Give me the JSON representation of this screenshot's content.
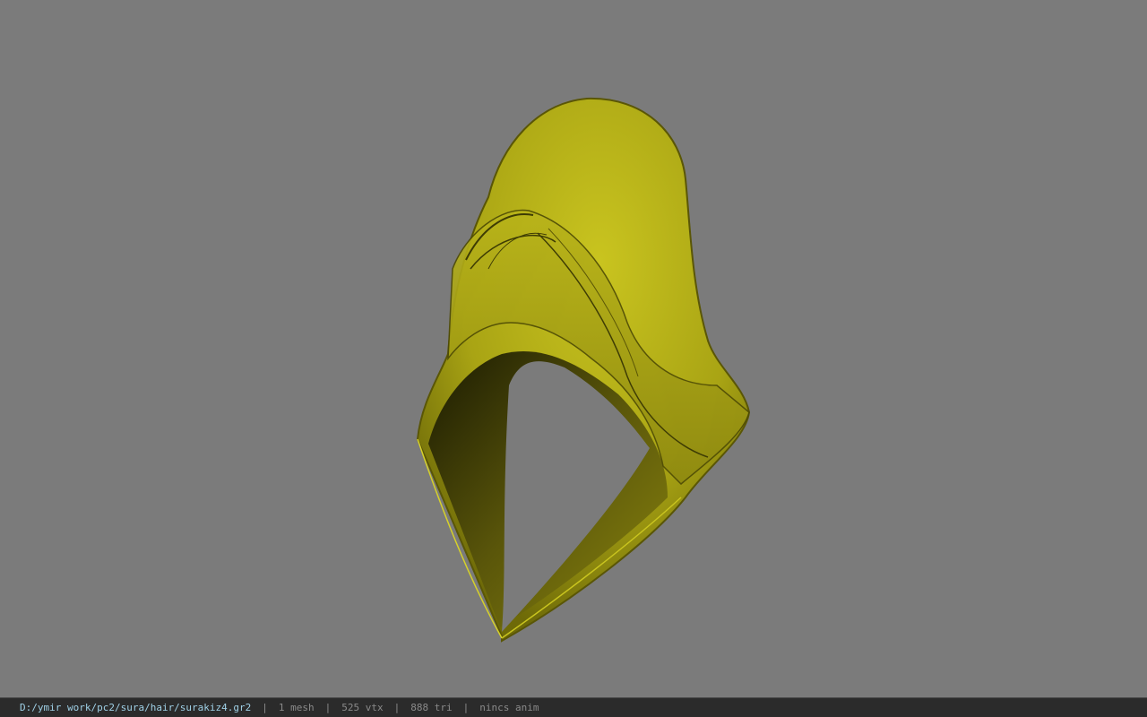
{
  "viewport": {
    "background_color": "#7b7b7b",
    "model": {
      "icon": "hood-mesh",
      "color": "#c2be1a"
    }
  },
  "status_bar": {
    "file_path": "D:/ymir work/pc2/sura/hair/surakiz4.gr2",
    "separator": "|",
    "mesh_count": "1 mesh",
    "vertex_count": "525 vtx",
    "triangle_count": "888 tri",
    "anim_status": "nincs anim"
  }
}
